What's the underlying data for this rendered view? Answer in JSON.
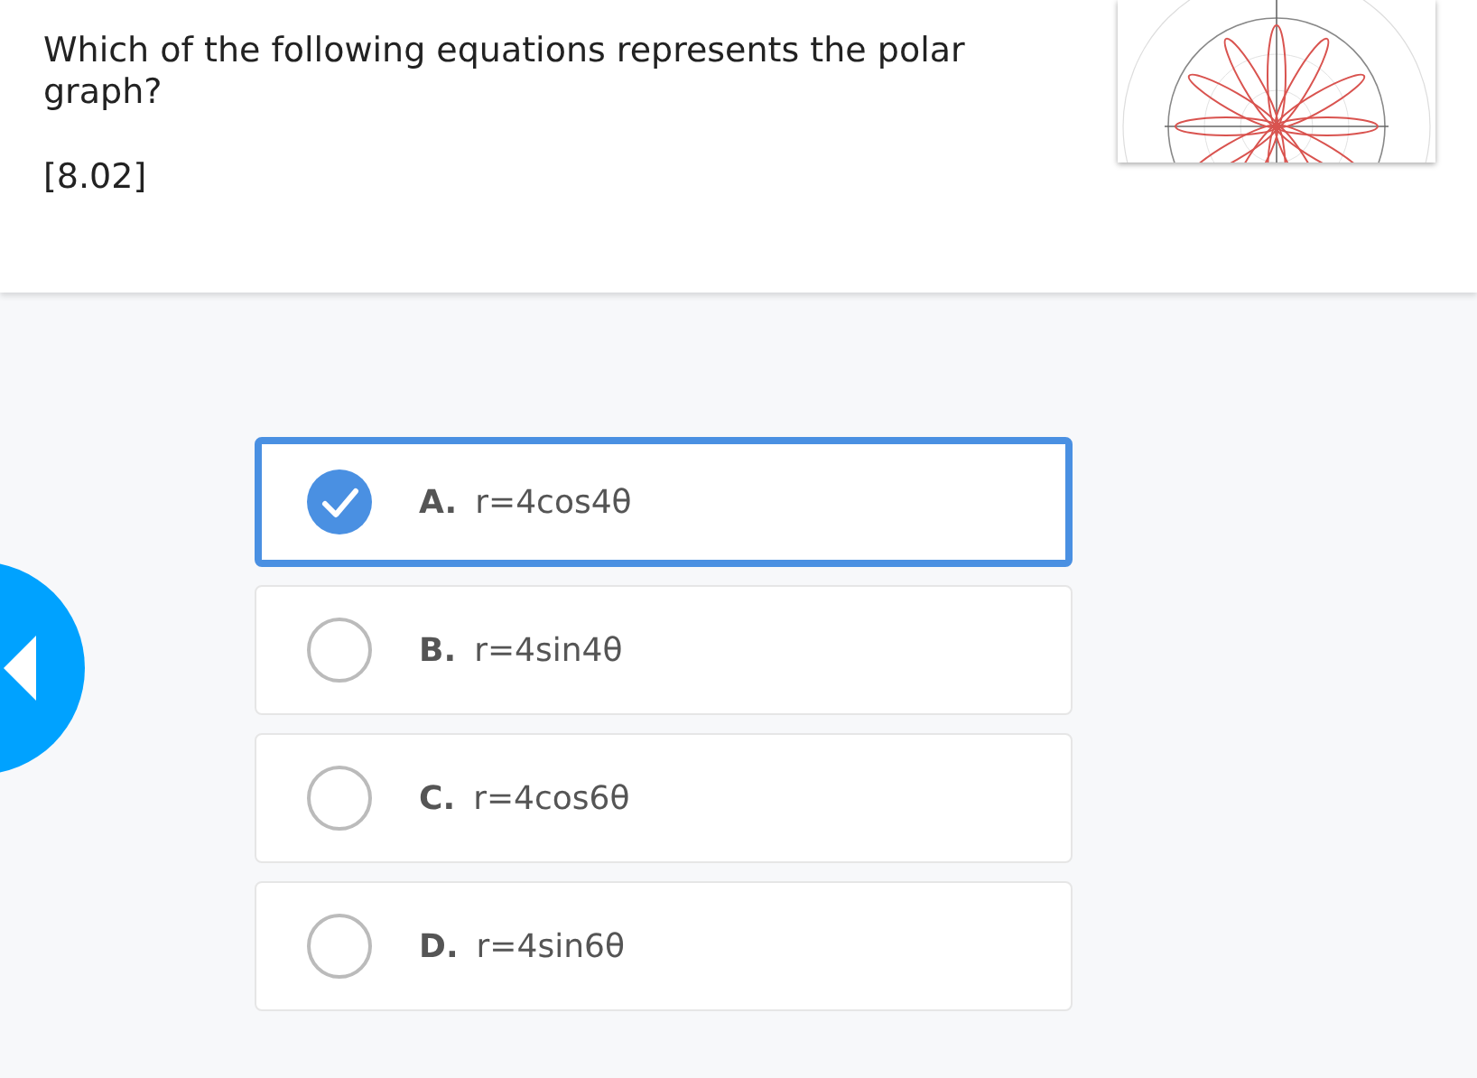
{
  "question": {
    "text": "Which of the following equations represents the polar graph?",
    "code": "[8.02]"
  },
  "options": [
    {
      "letter": "A.",
      "text": "r=4cos4θ",
      "selected": true
    },
    {
      "letter": "B.",
      "text": "r=4sin4θ",
      "selected": false
    },
    {
      "letter": "C.",
      "text": "r=4cos6θ",
      "selected": false
    },
    {
      "letter": "D.",
      "text": "r=4sin6θ",
      "selected": false
    }
  ]
}
